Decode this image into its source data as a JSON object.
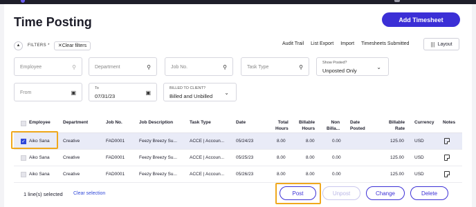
{
  "app": {
    "title": "Time Posting",
    "add_button": "Add Timesheet"
  },
  "filters": {
    "label": "FILTERS *",
    "clear_label": "✕Clear filters",
    "links": [
      "Audit Trail",
      "List Export",
      "Import",
      "Timesheets Submitted"
    ],
    "layout_label": "Layout",
    "employee_placeholder": "Employee",
    "department_placeholder": "Department",
    "job_placeholder": "Job No.",
    "task_placeholder": "Task Type",
    "show_posted_label": "Show Posted?",
    "show_posted_value": "Unposted Only",
    "from_placeholder": "From",
    "to_label": "To",
    "to_value": "07/31/23",
    "billed_label": "BILLED TO CLIENT?",
    "billed_value": "Billed and Unbilled"
  },
  "table": {
    "headers": {
      "employee": "Employee",
      "department": "Department",
      "job_no": "Job No.",
      "job_description": "Job Description",
      "task_type": "Task Type",
      "date": "Date",
      "total_hours_1": "Total",
      "total_hours_2": "Hours",
      "billable_hours_1": "Billable",
      "billable_hours_2": "Hours",
      "non_billable_1": "Non",
      "non_billable_2": "Billa...",
      "date_posted_1": "Date",
      "date_posted_2": "Posted",
      "billable_rate_1": "Billable",
      "billable_rate_2": "Rate",
      "currency": "Currency",
      "notes": "Notes"
    },
    "rows": [
      {
        "employee": "Aiko Sana",
        "department": "Creative",
        "job_no": "FAD0001",
        "job_description": "Feezy Breezy Su...",
        "task_type": "ACCE | Accoun...",
        "date": "05/24/23",
        "total_hours": "8.00",
        "billable_hours": "8.00",
        "non_billable": "0.00",
        "date_posted": "",
        "billable_rate": "125.00",
        "currency": "USD",
        "selected": true
      },
      {
        "employee": "Aiko Sana",
        "department": "Creative",
        "job_no": "FAD0001",
        "job_description": "Feezy Breezy Su...",
        "task_type": "ACCE | Accoun...",
        "date": "05/25/23",
        "total_hours": "8.00",
        "billable_hours": "8.00",
        "non_billable": "0.00",
        "date_posted": "",
        "billable_rate": "125.00",
        "currency": "USD",
        "selected": false
      },
      {
        "employee": "Aiko Sana",
        "department": "Creative",
        "job_no": "FAD0001",
        "job_description": "Feezy Breezy Su...",
        "task_type": "ACCE | Accoun...",
        "date": "05/26/23",
        "total_hours": "8.00",
        "billable_hours": "8.00",
        "non_billable": "0.00",
        "date_posted": "",
        "billable_rate": "125.00",
        "currency": "USD",
        "selected": false
      }
    ]
  },
  "footer": {
    "selected_text": "1 line(s) selected",
    "clear_selection": "Clear selection",
    "post": "Post",
    "unpost": "Unpost",
    "change": "Change",
    "delete": "Delete"
  },
  "colors": {
    "accent": "#3b2fd6",
    "highlight": "#f0a81c",
    "selected_row": "#e9ebf7"
  }
}
